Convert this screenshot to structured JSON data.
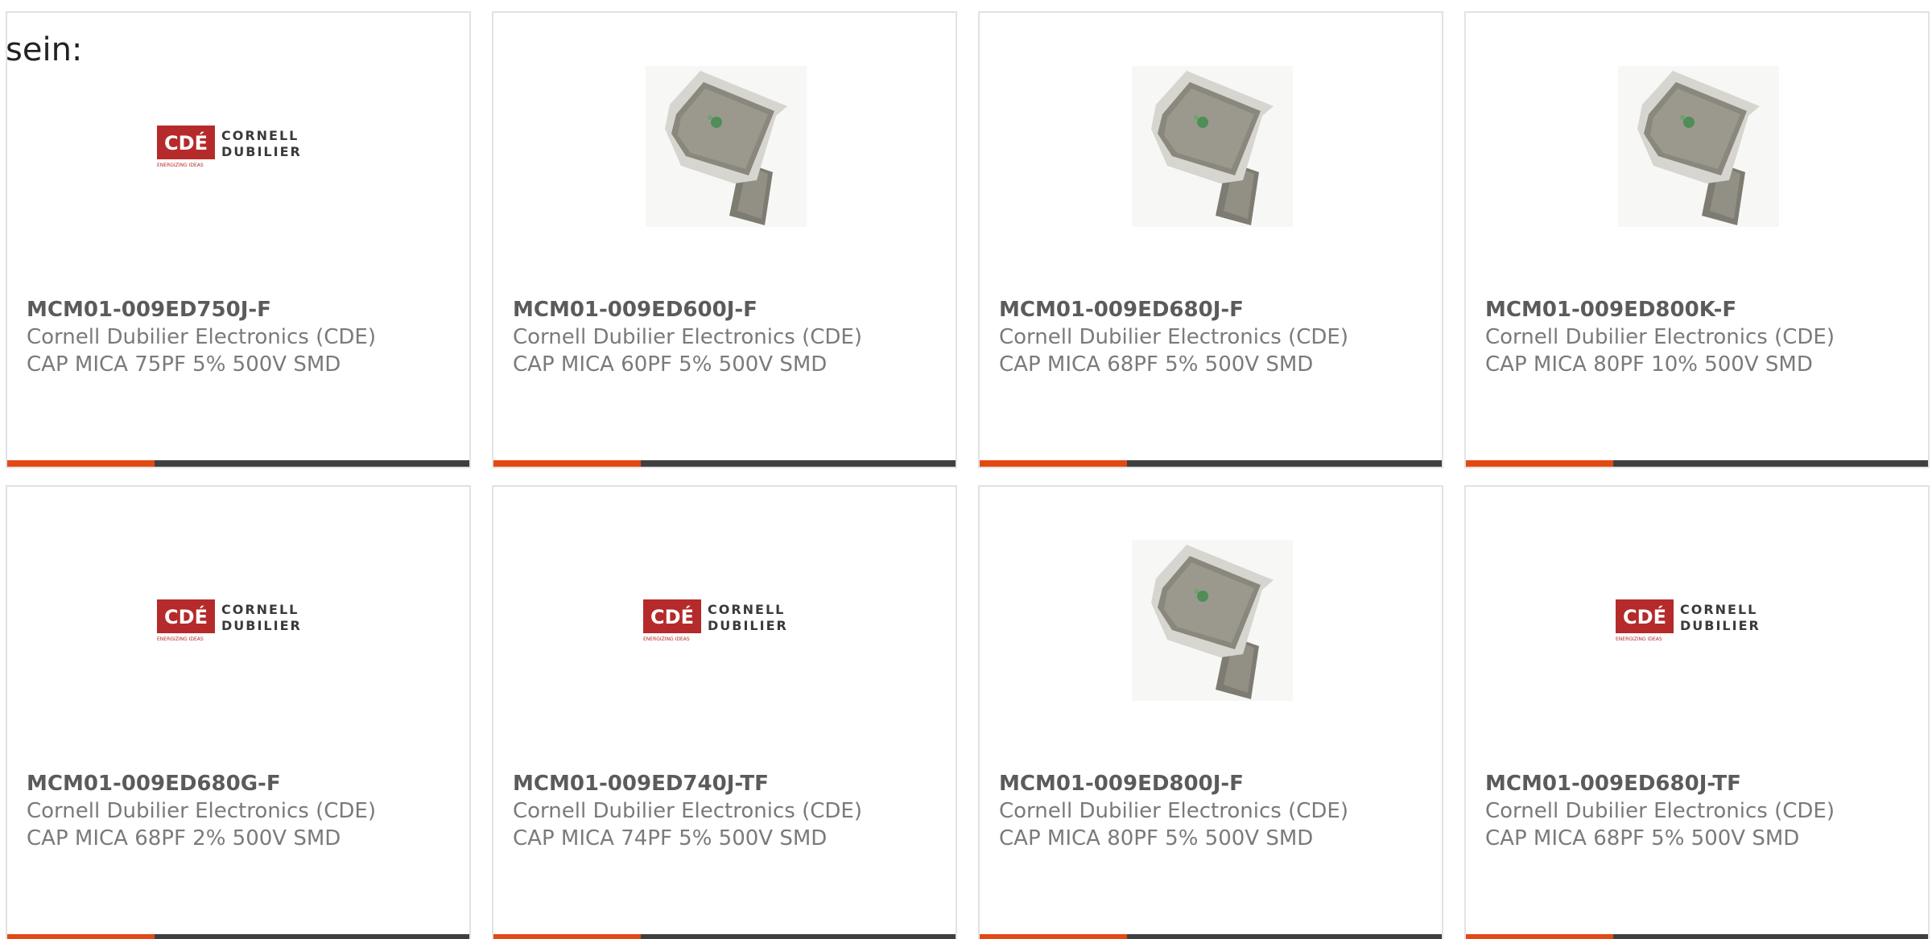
{
  "intro_text": "sein:",
  "colors": {
    "accent": "#e24a14",
    "bar": "#3f3f3f",
    "logo_red": "#b52a2a",
    "card_border": "#e2e2e2"
  },
  "products": [
    {
      "part_number": "MCM01-009ED750J-F",
      "manufacturer": "Cornell Dubilier Electronics (CDE)",
      "description": "CAP MICA 75PF 5% 500V SMD",
      "image": "cde-logo",
      "logo_text": {
        "badge": "CDÉ",
        "line1": "CORNELL",
        "line2": "DUBILIER",
        "tagline": "ENERGIZING IDEAS"
      }
    },
    {
      "part_number": "MCM01-009ED600J-F",
      "manufacturer": "Cornell Dubilier Electronics (CDE)",
      "description": "CAP MICA 60PF 5% 500V SMD",
      "image": "smd-capacitor-photo"
    },
    {
      "part_number": "MCM01-009ED680J-F",
      "manufacturer": "Cornell Dubilier Electronics (CDE)",
      "description": "CAP MICA 68PF 5% 500V SMD",
      "image": "smd-capacitor-photo"
    },
    {
      "part_number": "MCM01-009ED800K-F",
      "manufacturer": "Cornell Dubilier Electronics (CDE)",
      "description": "CAP MICA 80PF 10% 500V SMD",
      "image": "smd-capacitor-photo"
    },
    {
      "part_number": "MCM01-009ED680G-F",
      "manufacturer": "Cornell Dubilier Electronics (CDE)",
      "description": "CAP MICA 68PF 2% 500V SMD",
      "image": "cde-logo",
      "logo_text": {
        "badge": "CDÉ",
        "line1": "CORNELL",
        "line2": "DUBILIER",
        "tagline": "ENERGIZING IDEAS"
      }
    },
    {
      "part_number": "MCM01-009ED740J-TF",
      "manufacturer": "Cornell Dubilier Electronics (CDE)",
      "description": "CAP MICA 74PF 5% 500V SMD",
      "image": "cde-logo",
      "logo_text": {
        "badge": "CDÉ",
        "line1": "CORNELL",
        "line2": "DUBILIER",
        "tagline": "ENERGIZING IDEAS"
      }
    },
    {
      "part_number": "MCM01-009ED800J-F",
      "manufacturer": "Cornell Dubilier Electronics (CDE)",
      "description": "CAP MICA 80PF 5% 500V SMD",
      "image": "smd-capacitor-photo"
    },
    {
      "part_number": "MCM01-009ED680J-TF",
      "manufacturer": "Cornell Dubilier Electronics (CDE)",
      "description": "CAP MICA 68PF 5% 500V SMD",
      "image": "cde-logo",
      "logo_text": {
        "badge": "CDÉ",
        "line1": "CORNELL",
        "line2": "DUBILIER",
        "tagline": "ENERGIZING IDEAS"
      }
    }
  ]
}
